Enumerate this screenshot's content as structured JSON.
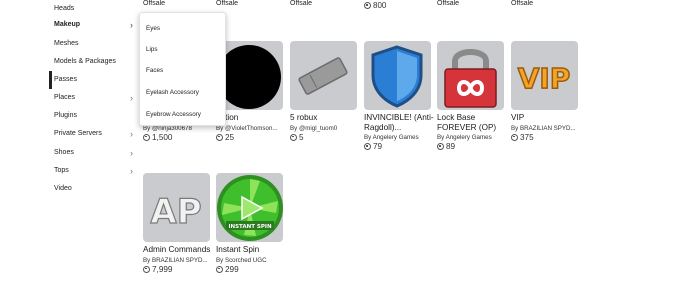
{
  "sidebar": {
    "items": [
      {
        "label": "Heads",
        "chevron": false
      },
      {
        "label": "Makeup",
        "chevron": true,
        "active": true
      },
      {
        "label": "Meshes",
        "chevron": false
      },
      {
        "label": "Models & Packages",
        "chevron": false
      },
      {
        "label": "Passes",
        "chevron": false,
        "selected": true
      },
      {
        "label": "Places",
        "chevron": true
      },
      {
        "label": "Plugins",
        "chevron": false
      },
      {
        "label": "Private Servers",
        "chevron": true
      },
      {
        "label": "Shoes",
        "chevron": true
      },
      {
        "label": "Tops",
        "chevron": true
      },
      {
        "label": "Video",
        "chevron": false
      }
    ]
  },
  "dropdown": {
    "items": [
      "Eyes",
      "Lips",
      "Faces",
      "Eyelash Accessory",
      "Eyebrow Accessory"
    ]
  },
  "top_row": {
    "captions": [
      "Offsale",
      "Offsale",
      "Offsale",
      "Offsale",
      "Offsale"
    ],
    "price": "800"
  },
  "items": [
    {
      "title": "",
      "creator": "By @ninja300678",
      "price": "1,500"
    },
    {
      "title": "nation",
      "creator": "By @VioletThomson...",
      "price": "25"
    },
    {
      "title": "5 robux",
      "creator": "By @migl_tuom0",
      "price": "5"
    },
    {
      "title": "INVINCIBLE! (Anti-Ragdoll)...",
      "creator": "By Angelery Games",
      "price": "79"
    },
    {
      "title": "Lock Base FOREVER (OP)",
      "creator": "By Angelery Games",
      "price": "89"
    },
    {
      "title": "VIP",
      "creator": "By BRAZILIAN SPYD...",
      "price": "375"
    },
    {
      "title": "Admin Commands",
      "creator": "By BRAZILIAN SPYD...",
      "price": "7,999"
    },
    {
      "title": "Instant Spin",
      "creator": "By Scorched UGC",
      "price": "299"
    }
  ],
  "thumb_text": {
    "vip": "VIP",
    "ap": "AP",
    "spin": "INSTANT SPIN"
  },
  "colors": {
    "thumb_bg": "#c9cbcf",
    "shield": "#2a7fd4",
    "lock_red": "#d6343b",
    "vip_gold": "#f4a425",
    "spin_green": "#3fbf2c"
  }
}
